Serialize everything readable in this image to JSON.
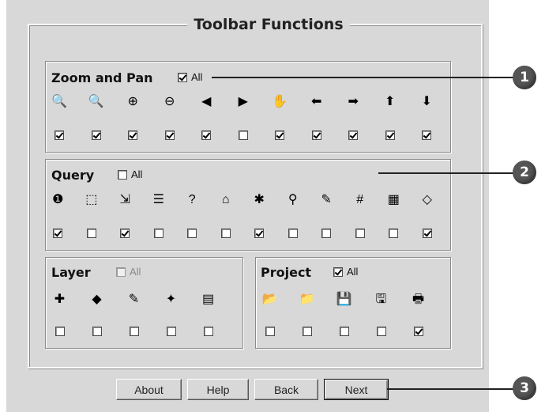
{
  "dialog": {
    "title": "Toolbar Functions"
  },
  "zoom": {
    "title": "Zoom and Pan",
    "all_label": "All",
    "all_checked": true,
    "icons": [
      "zoom-in-rect-icon",
      "zoom-out-rect-icon",
      "zoom-in-icon",
      "zoom-out-icon",
      "previous-extent-icon",
      "next-extent-icon",
      "pan-hand-icon",
      "pan-left-icon",
      "pan-right-icon",
      "pan-up-icon",
      "pan-down-icon"
    ],
    "glyphs": [
      "🔍",
      "🔍",
      "⊕",
      "⊖",
      "◀",
      "▶",
      "✋",
      "⬅",
      "➡",
      "⬆",
      "⬇"
    ],
    "checks": [
      true,
      true,
      true,
      true,
      true,
      false,
      true,
      true,
      true,
      true,
      true
    ]
  },
  "query": {
    "title": "Query",
    "all_label": "All",
    "all_checked": false,
    "icons": [
      "identify-icon",
      "select-feature-icon",
      "measure-icon",
      "attributes-icon",
      "query-builder-icon",
      "find-address-icon",
      "hyperlink-icon",
      "find-icon",
      "select-icon",
      "buffer-icon",
      "table-icon",
      "clear-icon"
    ],
    "glyphs": [
      "❶",
      "⬚",
      "⇲",
      "☰",
      "?",
      "⌂",
      "✱",
      "⚲",
      "✎",
      "#",
      "▦",
      "◇"
    ],
    "checks": [
      true,
      false,
      true,
      false,
      false,
      false,
      true,
      false,
      false,
      false,
      false,
      true
    ]
  },
  "layer": {
    "title": "Layer",
    "all_label": "All",
    "all_checked": false,
    "icons": [
      "add-layer-icon",
      "layer-properties-icon",
      "edit-layer-icon",
      "legend-icon",
      "layer-info-icon"
    ],
    "glyphs": [
      "✚",
      "◆",
      "✎",
      "✦",
      "▤"
    ],
    "checks": [
      false,
      false,
      false,
      false,
      false
    ]
  },
  "project": {
    "title": "Project",
    "all_label": "All",
    "all_checked": true,
    "icons": [
      "open-folder-icon",
      "open-project-icon",
      "save-icon",
      "save-as-icon",
      "print-icon"
    ],
    "glyphs": [
      "📂",
      "📁",
      "💾",
      "🖫",
      "🖶"
    ],
    "checks": [
      false,
      false,
      false,
      false,
      true
    ]
  },
  "buttons": {
    "about": "About",
    "help": "Help",
    "back": "Back",
    "next": "Next"
  },
  "callouts": [
    "1",
    "2",
    "3"
  ]
}
